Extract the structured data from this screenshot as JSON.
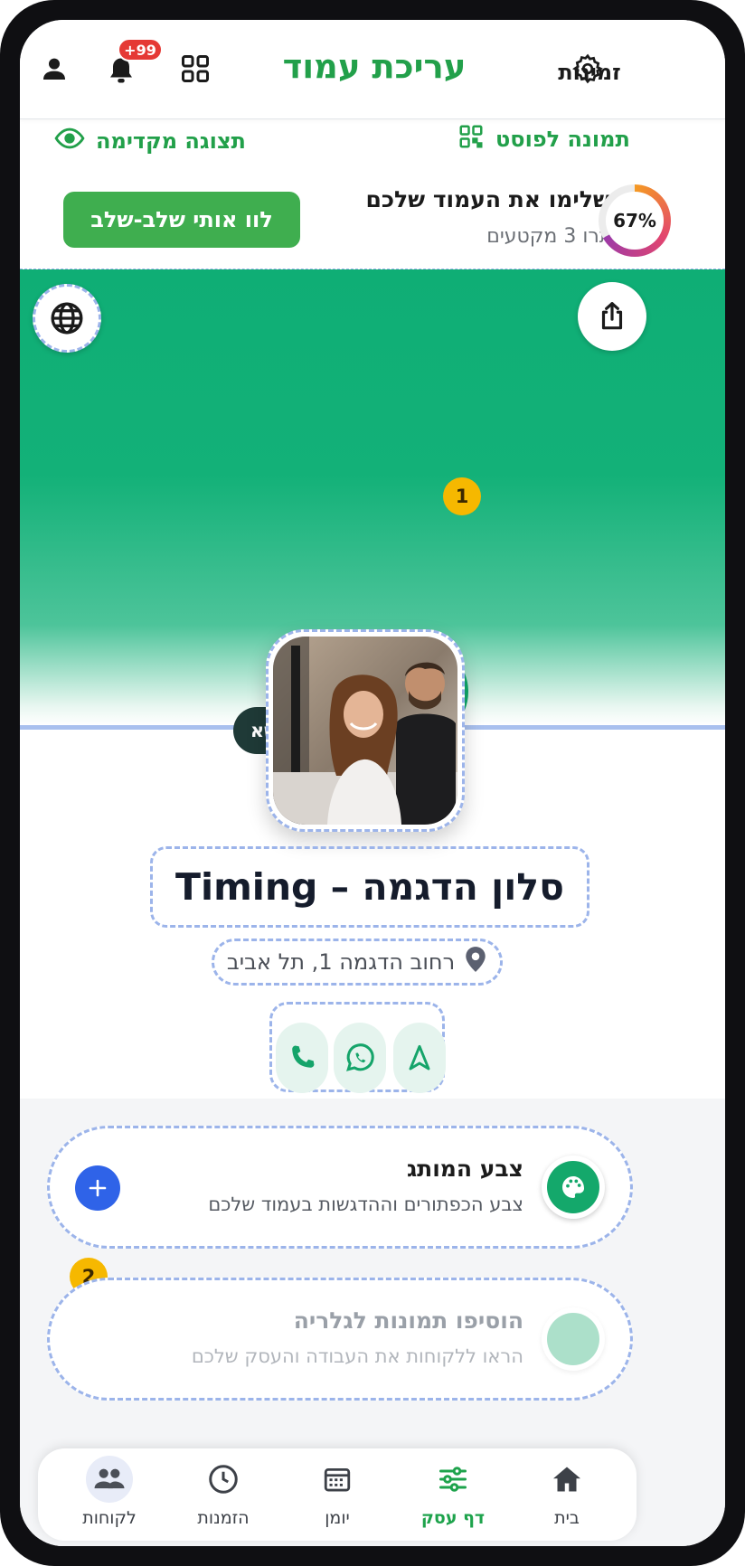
{
  "header": {
    "title": "עריכת עמוד",
    "appointments_label": "זמינות",
    "notifications_badge": "+99"
  },
  "actions": {
    "preview_label": "תצוגה מקדימה",
    "post_image_label": "תמונה לפוסט",
    "guide_button": "לוו אותי שלב-שלב",
    "complete_title": "השלימו את העמוד שלכם",
    "complete_sub": "נותרו 3 מקטעים",
    "progress_text": "67%",
    "progress_value": 67
  },
  "hero": {
    "add_cover_label": "הוסיפו תמונת נושא",
    "step1": "1"
  },
  "business": {
    "name": "סלון הדגמה – Timing",
    "address": "רחוב הדגמה 1, תל אביב"
  },
  "settings": {
    "brand_color_title": "צבע המותג",
    "brand_color_desc": "צבע הכפתורים וההדגשות בעמוד שלכם",
    "gallery_title": "הוסיפו תמונות לגלריה",
    "gallery_desc": "הראו ללקוחות את העבודה והעסק שלכם",
    "step2": "2"
  },
  "nav": {
    "home": "בית",
    "business_page": "דף עסק",
    "calendar": "יומן",
    "appointments": "הזמנות",
    "customers": "לקוחות"
  },
  "colors": {
    "accent": "#22a04a",
    "hero": "#13b178",
    "badge": "#e53935",
    "step": "#f6b800",
    "plus": "#2f63e8"
  }
}
